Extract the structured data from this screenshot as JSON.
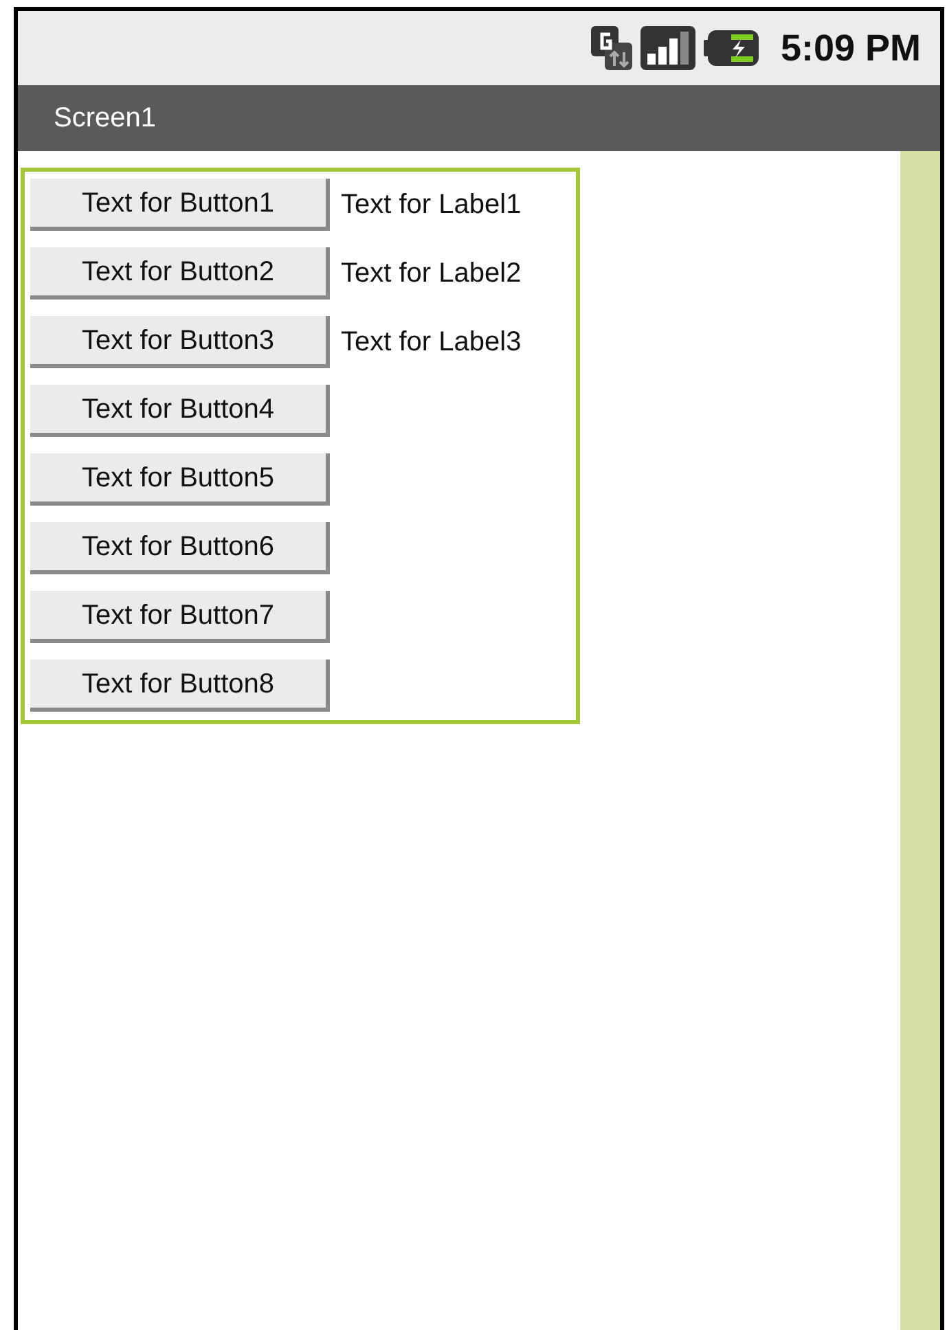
{
  "status_bar": {
    "time": "5:09 PM"
  },
  "title_bar": {
    "title": "Screen1"
  },
  "buttons": [
    "Text for Button1",
    "Text for Button2",
    "Text for Button3",
    "Text for Button4",
    "Text for Button5",
    "Text for Button6",
    "Text for Button7",
    "Text for Button8"
  ],
  "labels": [
    "Text for Label1",
    "Text for Label2",
    "Text for Label3"
  ]
}
